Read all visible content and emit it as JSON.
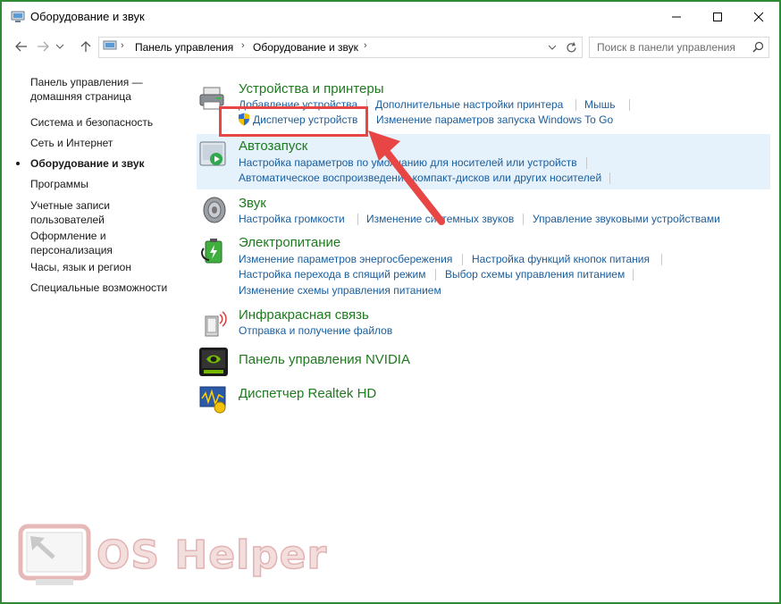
{
  "window": {
    "title": "Оборудование и звук",
    "minimize_glyph": "—",
    "maximize_glyph": "☐",
    "close_glyph": "✕"
  },
  "toolbar": {
    "back_icon": "arrow-left-icon",
    "forward_icon": "arrow-right-icon",
    "history_icon": "chevron-down-icon",
    "up_icon": "arrow-up-icon"
  },
  "breadcrumb": {
    "items": [
      "Панель управления",
      "Оборудование и звук"
    ],
    "sep": "›"
  },
  "search": {
    "placeholder": "Поиск в панели управления"
  },
  "sidebar": {
    "items": [
      {
        "label": "Панель управления —\nдомашняя страница"
      },
      {
        "label": "Система и безопасность"
      },
      {
        "label": "Сеть и Интернет"
      },
      {
        "label": "Оборудование и звук",
        "active": true
      },
      {
        "label": "Программы"
      },
      {
        "label": "Учетные записи\nпользователей"
      },
      {
        "label": "Оформление и\nперсонализация"
      },
      {
        "label": "Часы, язык и регион"
      },
      {
        "label": "Специальные возможности"
      }
    ]
  },
  "categories": {
    "devices": {
      "title": "Устройства и принтеры",
      "links": [
        "Добавление устройства",
        "Дополнительные настройки принтера",
        "Мышь",
        "Диспетчер устройств",
        "Изменение параметров запуска Windows To Go"
      ]
    },
    "autoplay": {
      "title": "Автозапуск",
      "links": [
        "Настройка параметров по умолчанию для носителей или устройств",
        "Автоматическое воспроизведение компакт-дисков или других носителей"
      ]
    },
    "sound": {
      "title": "Звук",
      "links": [
        "Настройка громкости",
        "Изменение системных звуков",
        "Управление звуковыми устройствами"
      ]
    },
    "power": {
      "title": "Электропитание",
      "links": [
        "Изменение параметров энергосбережения",
        "Настройка функций кнопок питания",
        "Настройка перехода в спящий режим",
        "Выбор схемы управления питанием",
        "Изменение схемы управления питанием"
      ]
    },
    "infrared": {
      "title": "Инфракрасная связь",
      "links": [
        "Отправка и получение файлов"
      ]
    },
    "nvidia": {
      "title": "Панель управления NVIDIA"
    },
    "realtek": {
      "title": "Диспетчер Realtek HD"
    }
  },
  "watermark": {
    "text": "OS Helper"
  },
  "colors": {
    "border": "#2e8b34",
    "link": "#1a5d9c",
    "category_title": "#1e7a1e",
    "highlight_bg": "#e5f1fb",
    "annotation_red": "#e84545"
  }
}
